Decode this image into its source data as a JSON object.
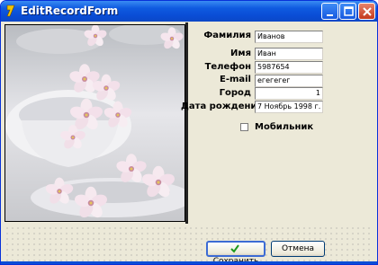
{
  "window": {
    "title": "EditRecordForm"
  },
  "fields": [
    {
      "label": "Фамилия",
      "value": "Иванов"
    },
    {
      "label": "Имя",
      "value": "Иван"
    },
    {
      "label": "Телефон",
      "value": "5987654"
    },
    {
      "label": "E-mail",
      "value": "егегегег"
    },
    {
      "label": "Город",
      "value": "1"
    },
    {
      "label": "Дата рождения",
      "value": "7 Ноябрь 1998 г."
    }
  ],
  "mobile": {
    "label": "Мобильник",
    "checked": false
  },
  "buttons": {
    "save": "Сохранить",
    "cancel": "Отмена"
  },
  "icons": {
    "app": "delphi-icon",
    "photo": "cherry-blossom-cups-photo",
    "save": "checkmark-icon"
  },
  "colors": {
    "titlebar": "#0a4dd6",
    "close": "#c4391c",
    "check": "#1e9a1e"
  }
}
